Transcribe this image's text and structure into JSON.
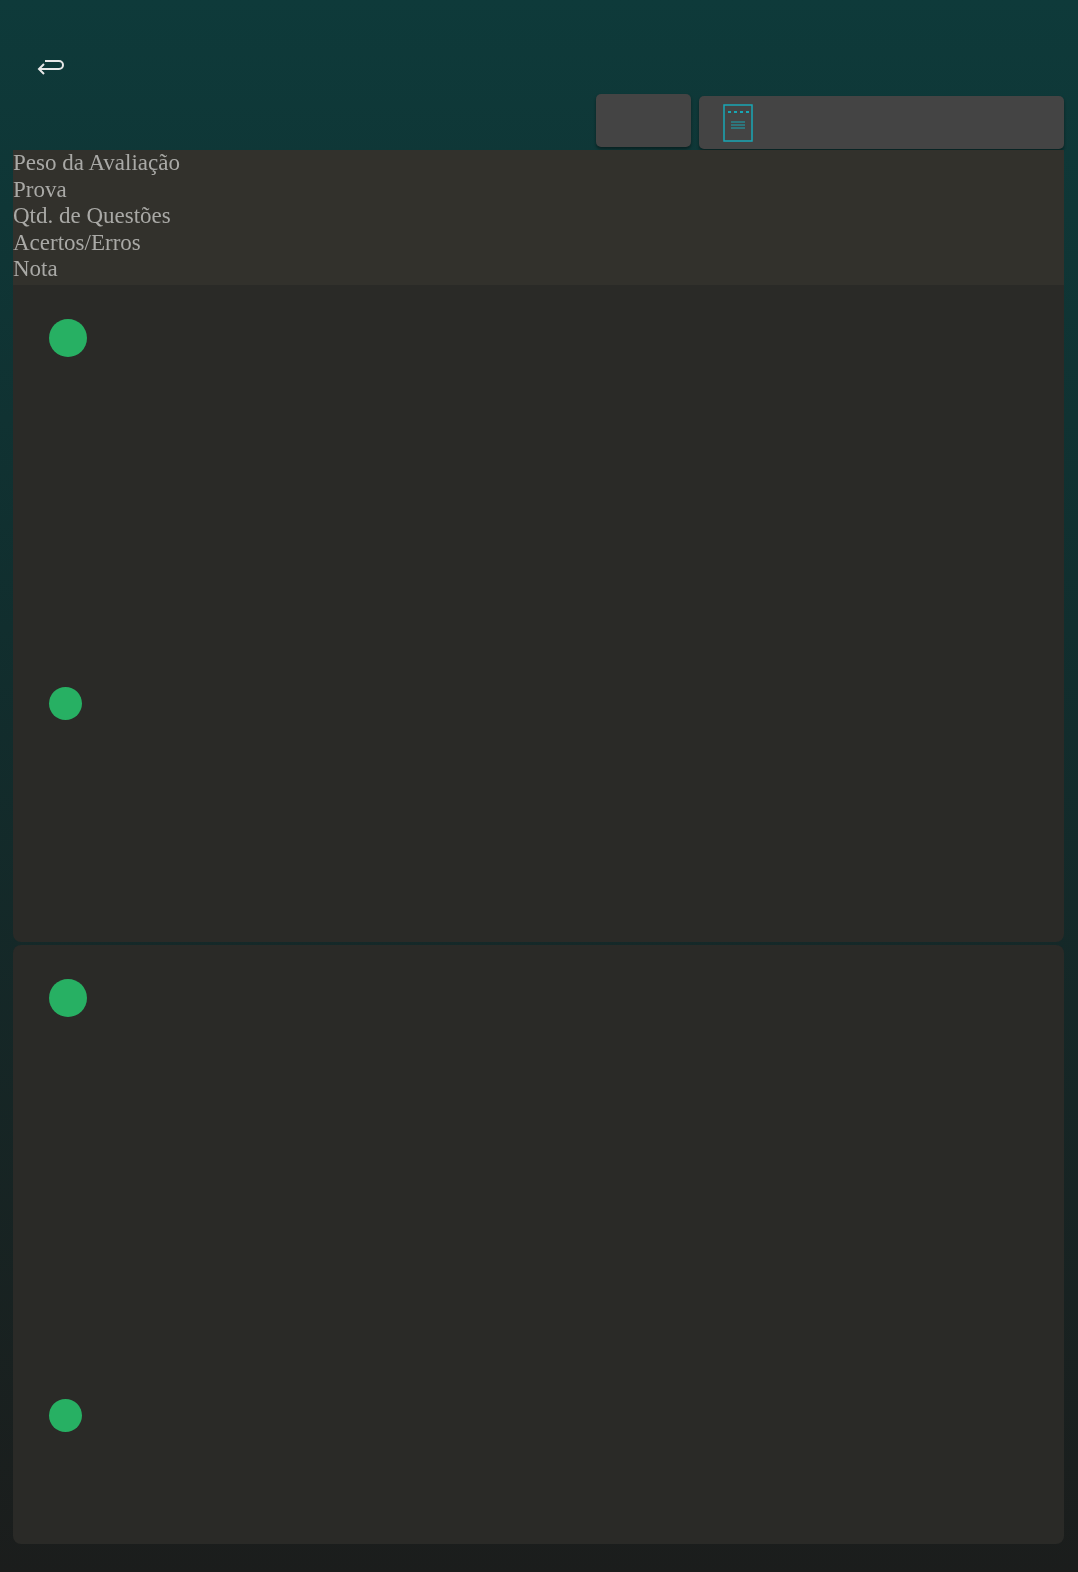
{
  "header_labels": [
    "Peso da Avaliação",
    "Prova",
    "Qtd. de Questões",
    "Acertos/Erros",
    "Nota"
  ],
  "cards": [
    {
      "dots": [
        {
          "kind": "large"
        },
        {
          "kind": "small"
        }
      ]
    },
    {
      "dots": [
        {
          "kind": "large"
        },
        {
          "kind": "small"
        }
      ]
    }
  ]
}
